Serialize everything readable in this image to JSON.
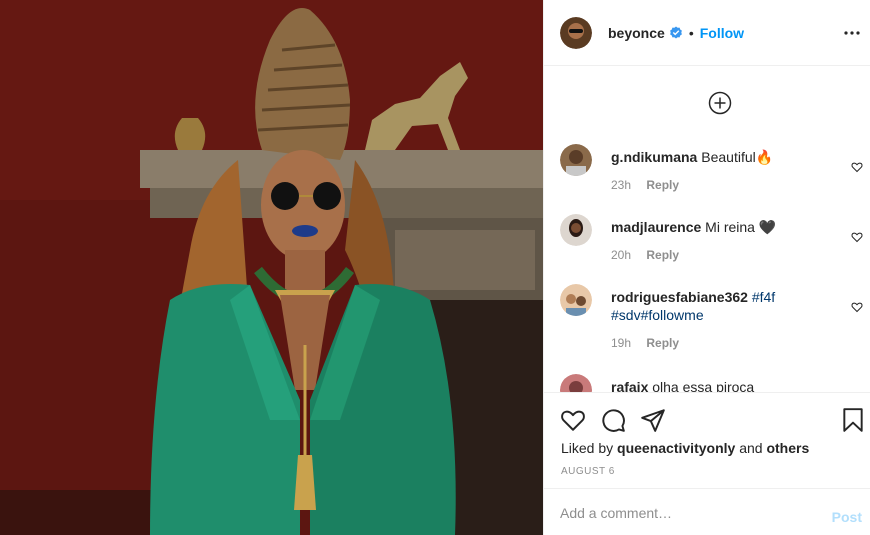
{
  "post": {
    "author": "beyonce",
    "follow_label": "Follow",
    "separator": "•",
    "icons": {
      "verified": "verified-badge-icon",
      "more": "more-options-icon",
      "load_more": "plus-circle-icon"
    }
  },
  "comments": [
    {
      "user": "g.ndikumana",
      "text": "Beautiful🔥",
      "time": "23h",
      "reply": "Reply"
    },
    {
      "user": "madjlaurence",
      "text": "Mi reina 🖤",
      "time": "20h",
      "reply": "Reply"
    },
    {
      "user": "rodriguesfabiane362",
      "tags": [
        "#f4f",
        "#sdv#followme"
      ],
      "time": "19h",
      "reply": "Reply"
    },
    {
      "user": "rafajx",
      "text": "olha essa piroca"
    }
  ],
  "actions": {
    "icons": [
      "heart-icon",
      "comment-icon",
      "share-icon",
      "bookmark-icon"
    ]
  },
  "likes": {
    "prefix": "Liked by",
    "user": "queenactivityonly",
    "and": "and",
    "others": "others"
  },
  "date": "AUGUST 6",
  "comment_box": {
    "placeholder": "Add a comment…",
    "post_label": "Post"
  },
  "colors": {
    "accent": "#0095f6",
    "post_disabled": "#b2dffc",
    "meta": "#8e8e8e",
    "hashtag": "#00376b"
  }
}
